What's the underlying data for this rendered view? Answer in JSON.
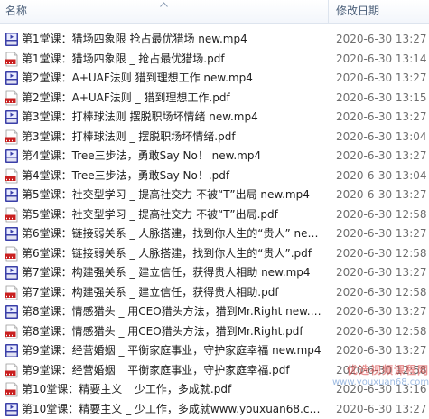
{
  "header": {
    "name_label": "名称",
    "date_label": "修改日期"
  },
  "icons": {
    "mp4": "video-mp4-icon",
    "pdf": "pdf-file-icon"
  },
  "colors": {
    "mp4_icon": "#3a3fa8",
    "pdf_icon": "#c92020",
    "header_text": "#4c607a"
  },
  "files": [
    {
      "name": "第1堂课：猎场四象限  抢占最优猎场 new.mp4",
      "date": "2020-6-30 13:27",
      "type": "mp4"
    },
    {
      "name": "第1堂课：猎场四象限 _ 抢占最优猎场.pdf",
      "date": "2020-6-30 13:14",
      "type": "pdf"
    },
    {
      "name": "第2堂课：A+UAF法则  猎到理想工作 new.mp4",
      "date": "2020-6-30 13:27",
      "type": "mp4"
    },
    {
      "name": "第2堂课：A+UAF法则 _ 猎到理想工作.pdf",
      "date": "2020-6-30 13:15",
      "type": "pdf"
    },
    {
      "name": "第3堂课：打棒球法则  摆脱职场坏情绪 new.mp4",
      "date": "2020-6-30 13:27",
      "type": "mp4"
    },
    {
      "name": "第3堂课：打棒球法则 _ 摆脱职场坏情绪.pdf",
      "date": "2020-6-30 13:04",
      "type": "pdf"
    },
    {
      "name": "第4堂课：Tree三步法，勇敢Say No！ new.mp4",
      "date": "2020-6-30 13:27",
      "type": "mp4"
    },
    {
      "name": "第4堂课：Tree三步法，勇敢Say No！.pdf",
      "date": "2020-6-30 13:04",
      "type": "pdf"
    },
    {
      "name": "第5堂课：社交型学习 _ 提高社交力 不被“T”出局 new.mp4",
      "date": "2020-6-30 13:27",
      "type": "mp4"
    },
    {
      "name": "第5堂课：社交型学习 _ 提高社交力 不被“T”出局.pdf",
      "date": "2020-6-30 12:58",
      "type": "pdf"
    },
    {
      "name": "第6堂课：链接弱关系 _ 人脉搭建，找到你人生的“贵人” new.mp4",
      "date": "2020-6-30 13:27",
      "type": "mp4"
    },
    {
      "name": "第6堂课：链接弱关系 _ 人脉搭建，找到你人生的“贵人”.pdf",
      "date": "2020-6-30 12:58",
      "type": "pdf"
    },
    {
      "name": "第7堂课：构建强关系 _ 建立信任，获得贵人相助 new.mp4",
      "date": "2020-6-30 13:27",
      "type": "mp4"
    },
    {
      "name": "第7堂课：构建强关系 _ 建立信任，获得贵人相助.pdf",
      "date": "2020-6-30 12:58",
      "type": "pdf"
    },
    {
      "name": "第8堂课：情感猎头 _ 用CEO猎头方法，猎到Mr.Right new.mp4",
      "date": "2020-6-30 13:27",
      "type": "mp4"
    },
    {
      "name": "第8堂课：情感猎头 _ 用CEO猎头方法，猎到Mr.Right.pdf",
      "date": "2020-6-30 12:58",
      "type": "pdf"
    },
    {
      "name": "第9堂课：经营婚姻 _ 平衡家庭事业，守护家庭幸福 new.mp4",
      "date": "2020-6-30 13:27",
      "type": "mp4"
    },
    {
      "name": "第9堂课：经营婚姻 _ 平衡家庭事业，守护家庭幸福.pdf",
      "date": "2020-6-30 12:58",
      "type": "pdf"
    },
    {
      "name": "第10堂课：精要主义 _ 少工作，多成就.pdf",
      "date": "2020-6-30 13:16",
      "type": "pdf"
    },
    {
      "name": "第10堂课：精要主义 _ 少工作，多成就www.youxuan68.com.mp4",
      "date": "2020-6-30 13:27",
      "type": "mp4"
    }
  ],
  "watermark": {
    "line1": "优选视频课程网",
    "line2": "www.youxuan68.com"
  }
}
